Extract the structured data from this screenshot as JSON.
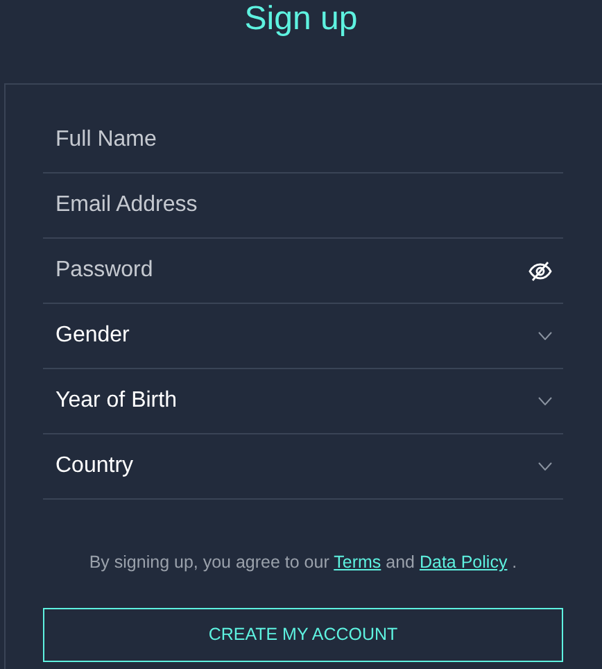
{
  "title": "Sign up",
  "fields": [
    {
      "kind": "text",
      "placeholder": "Full Name"
    },
    {
      "kind": "text",
      "placeholder": "Email Address"
    },
    {
      "kind": "password",
      "placeholder": "Password"
    },
    {
      "kind": "select",
      "label": "Gender"
    },
    {
      "kind": "select",
      "label": "Year of Birth"
    },
    {
      "kind": "select",
      "label": "Country"
    }
  ],
  "agreement": [
    {
      "kind": "text",
      "text": "By signing up, you agree to our "
    },
    {
      "kind": "link",
      "text": "Terms"
    },
    {
      "kind": "text",
      "text": " and "
    },
    {
      "kind": "link",
      "text": "Data Policy"
    },
    {
      "kind": "text",
      "text": " ."
    }
  ],
  "button": "CREATE MY ACCOUNT"
}
